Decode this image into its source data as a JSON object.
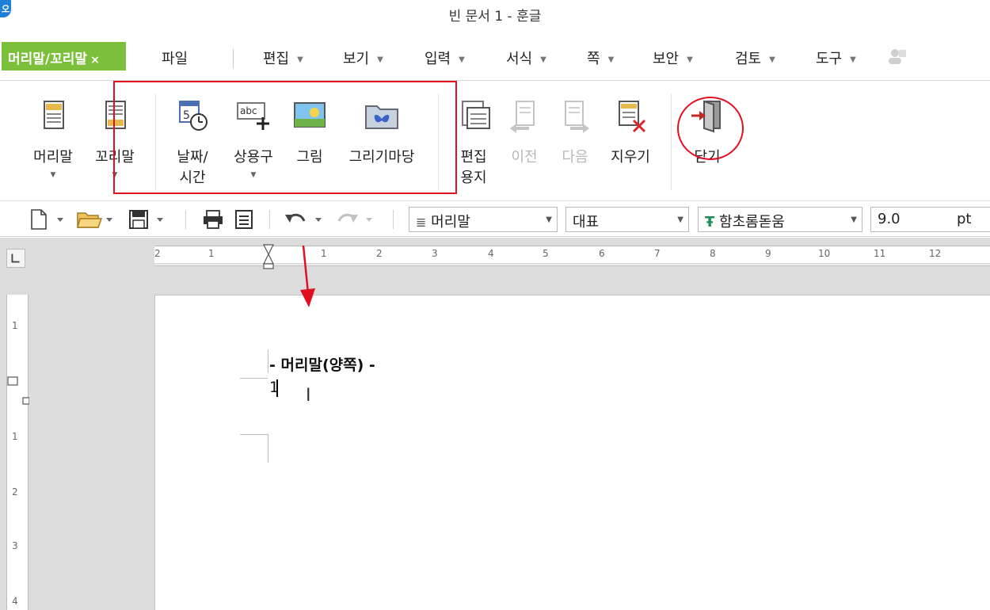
{
  "window": {
    "title": "빈 문서 1 - 훈글",
    "logo_glyph": "오"
  },
  "menubar": {
    "context_tab": {
      "label": "머리말/꼬리말",
      "close": "×",
      "color": "#7cbf3a"
    },
    "items": [
      {
        "label": "파일",
        "has_dropdown": false
      },
      {
        "label": "편집",
        "has_dropdown": true
      },
      {
        "label": "보기",
        "has_dropdown": true
      },
      {
        "label": "입력",
        "has_dropdown": true
      },
      {
        "label": "서식",
        "has_dropdown": true
      },
      {
        "label": "쪽",
        "has_dropdown": true
      },
      {
        "label": "보안",
        "has_dropdown": true
      },
      {
        "label": "검토",
        "has_dropdown": true
      },
      {
        "label": "도구",
        "has_dropdown": true
      }
    ]
  },
  "ribbon": {
    "buttons": [
      {
        "line1": "머리말",
        "line2": "",
        "has_dropdown": true,
        "enabled": true,
        "icon": "header-icon"
      },
      {
        "line1": "꼬리말",
        "line2": "",
        "has_dropdown": true,
        "enabled": true,
        "icon": "footer-icon"
      },
      {
        "line1": "날짜/",
        "line2": "시간",
        "has_dropdown": false,
        "enabled": true,
        "icon": "date-time-icon"
      },
      {
        "line1": "상용구",
        "line2": "",
        "has_dropdown": true,
        "enabled": true,
        "icon": "autotext-icon"
      },
      {
        "line1": "그림",
        "line2": "",
        "has_dropdown": false,
        "enabled": true,
        "icon": "picture-icon"
      },
      {
        "line1": "그리기마당",
        "line2": "",
        "has_dropdown": false,
        "enabled": true,
        "icon": "clipart-icon"
      },
      {
        "line1": "편집",
        "line2": "용지",
        "has_dropdown": false,
        "enabled": true,
        "icon": "edit-paper-icon"
      },
      {
        "line1": "이전",
        "line2": "",
        "has_dropdown": false,
        "enabled": false,
        "icon": "previous-icon"
      },
      {
        "line1": "다음",
        "line2": "",
        "has_dropdown": false,
        "enabled": false,
        "icon": "next-icon"
      },
      {
        "line1": "지우기",
        "line2": "",
        "has_dropdown": false,
        "enabled": true,
        "icon": "delete-icon"
      },
      {
        "line1": "닫기",
        "line2": "",
        "has_dropdown": false,
        "enabled": true,
        "icon": "close-door-icon"
      }
    ],
    "annotation_color": "#e01020"
  },
  "toolbar": {
    "style_combo": "머리말",
    "language_combo": "대표",
    "font_combo": "함초롬돋움",
    "font_icon_glyph": "Ŧ",
    "size_value": "9.0",
    "size_unit": "pt"
  },
  "ruler": {
    "horizontal_labels": [
      "2",
      "1",
      "1",
      "2",
      "3",
      "4",
      "5",
      "6",
      "7",
      "8",
      "9",
      "10",
      "11",
      "12"
    ],
    "vertical_labels": [
      "1",
      "1",
      "2",
      "3",
      "4"
    ]
  },
  "document": {
    "header_text": "- 머리말(양쪽) -",
    "page_number": "1"
  }
}
